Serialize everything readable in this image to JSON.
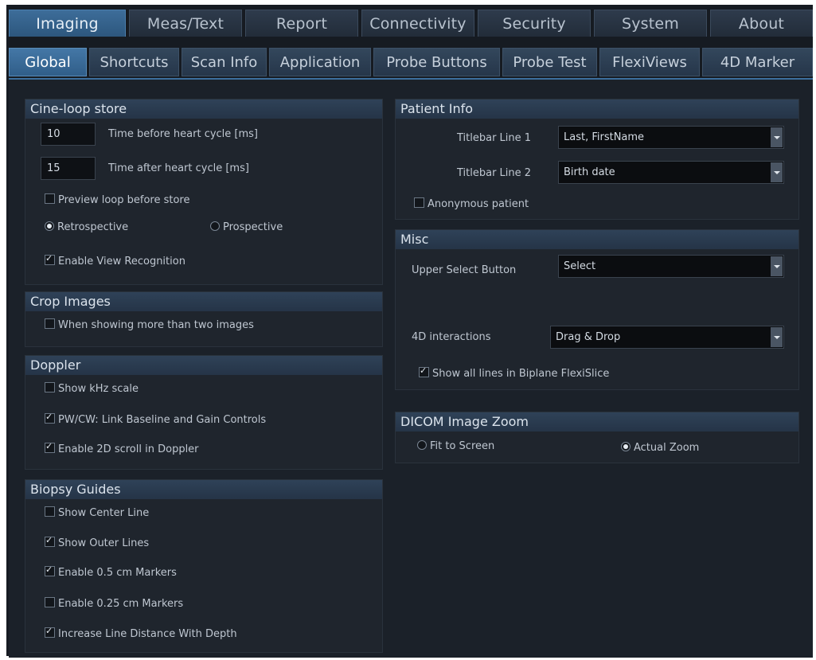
{
  "main_tabs": [
    "Imaging",
    "Meas/Text",
    "Report",
    "Connectivity",
    "Security",
    "System",
    "About"
  ],
  "sub_tabs": [
    "Global",
    "Shortcuts",
    "Scan Info",
    "Application",
    "Probe Buttons",
    "Probe Test",
    "FlexiViews",
    "4D Marker"
  ],
  "cine": {
    "title": "Cine-loop store",
    "before_value": "10",
    "before_label": "Time before heart cycle [ms]",
    "after_value": "15",
    "after_label": "Time after heart cycle [ms]",
    "preview_label": "Preview loop before store",
    "retro_label": "Retrospective",
    "prosp_label": "Prospective",
    "view_recog_label": "Enable View Recognition"
  },
  "crop": {
    "title": "Crop Images",
    "more_label": "When showing more than two images"
  },
  "doppler": {
    "title": "Doppler",
    "khz_label": "Show kHz scale",
    "pwcw_label": "PW/CW: Link Baseline and Gain Controls",
    "scroll_label": "Enable 2D scroll in Doppler"
  },
  "biopsy": {
    "title": "Biopsy Guides",
    "center_label": "Show Center Line",
    "outer_label": "Show Outer Lines",
    "m05_label": "Enable 0.5 cm Markers",
    "m025_label": "Enable 0.25 cm Markers",
    "increase_label": "Increase Line Distance With Depth"
  },
  "patient": {
    "title": "Patient Info",
    "line1_label": "Titlebar Line 1",
    "line1_value": "Last, FirstName",
    "line2_label": "Titlebar Line 2",
    "line2_value": "Birth date",
    "anon_label": "Anonymous patient"
  },
  "misc": {
    "title": "Misc",
    "upper_label": "Upper Select Button",
    "upper_value": "Select",
    "interact_label": "4D interactions",
    "interact_value": "Drag & Drop",
    "biplane_label": "Show all lines in Biplane FlexiSlice"
  },
  "dicom": {
    "title": "DICOM Image Zoom",
    "fit_label": "Fit to Screen",
    "actual_label": "Actual Zoom"
  }
}
